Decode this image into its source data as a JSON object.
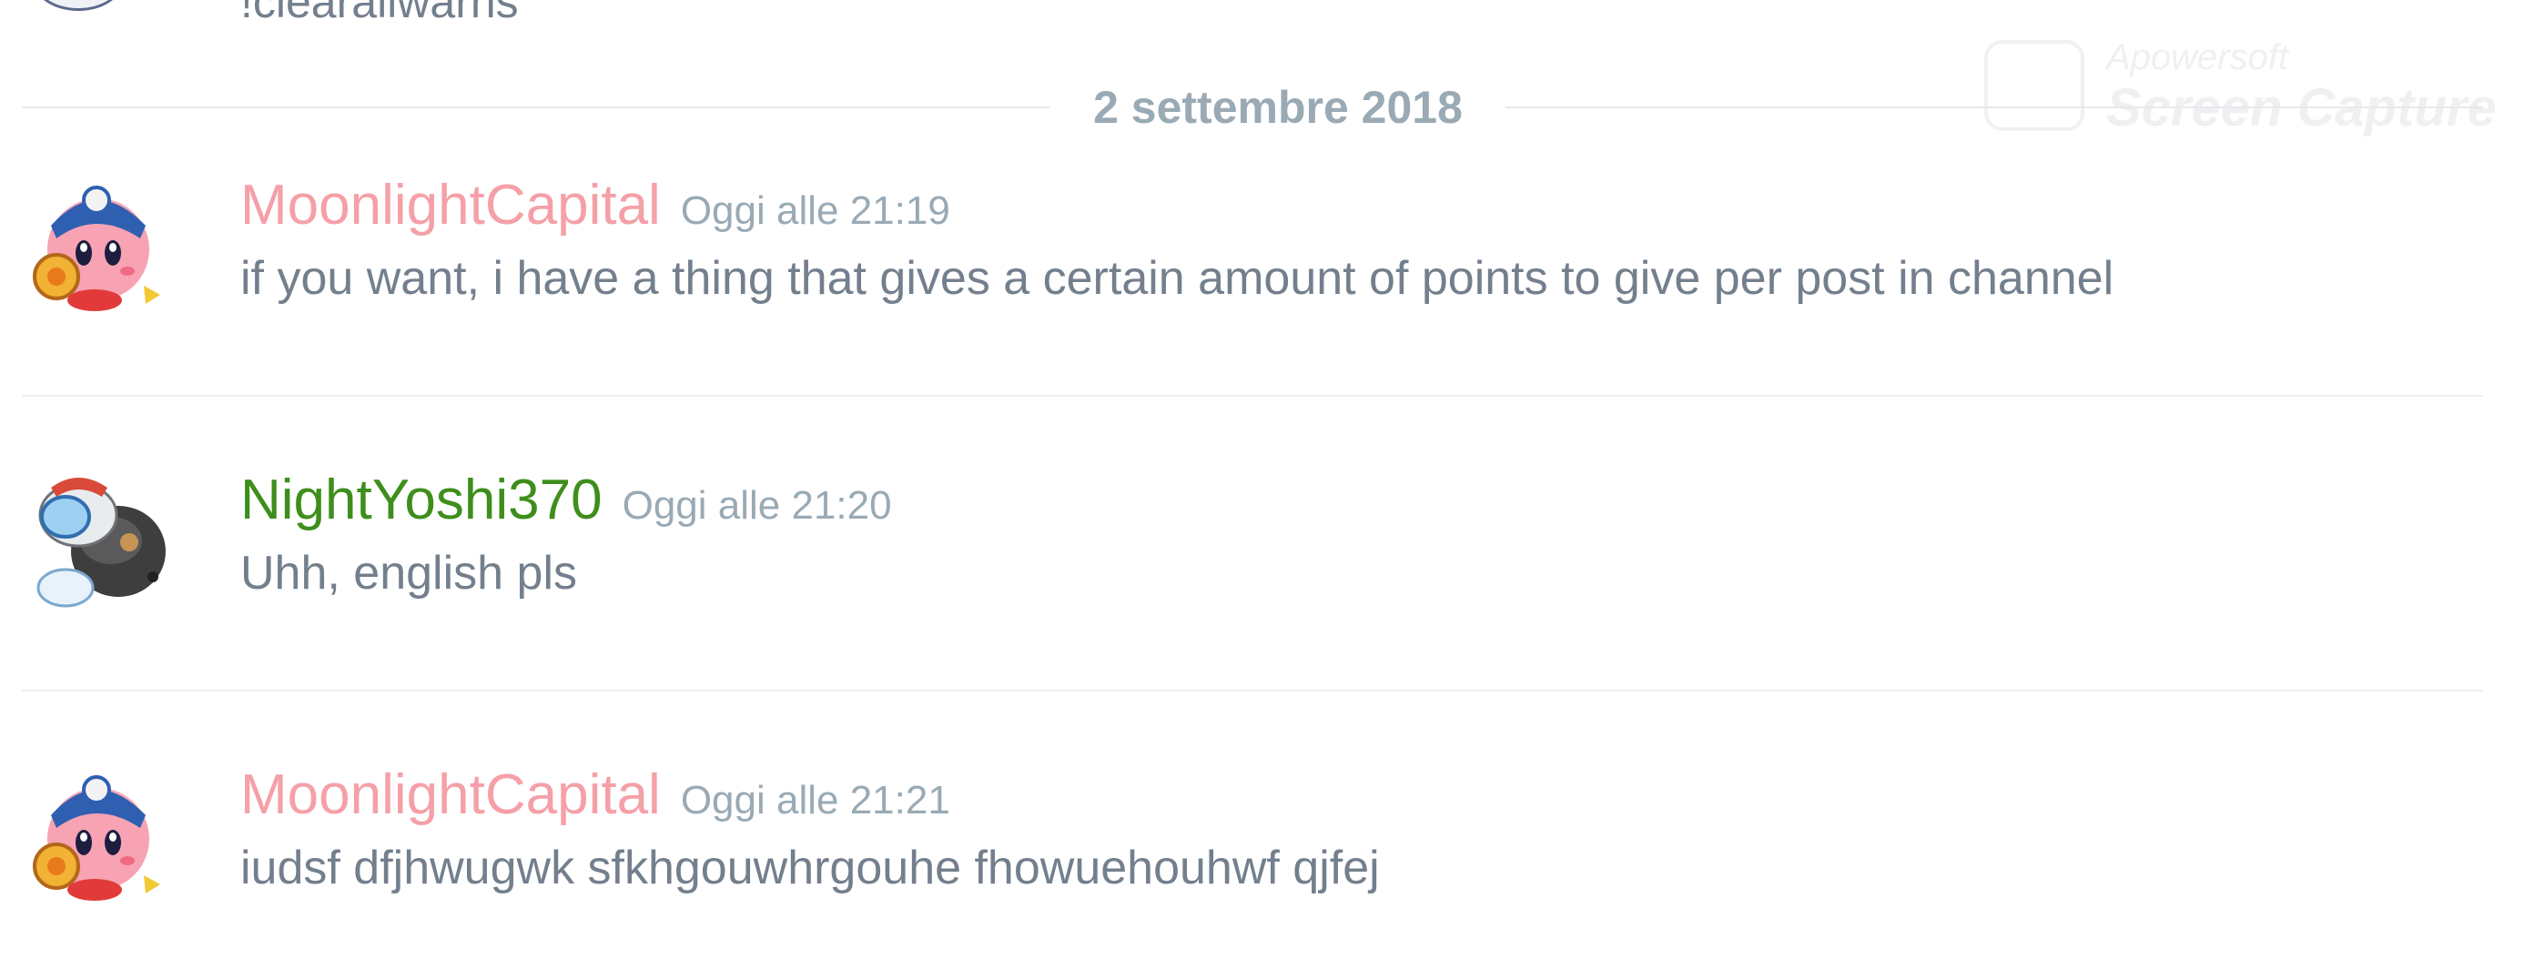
{
  "previous_message": {
    "content": "!clearallwarns"
  },
  "day_divider": {
    "label": "2 settembre 2018"
  },
  "messages": [
    {
      "username": "MoonlightCapital",
      "username_color": "#f5a0a8",
      "timestamp": "Oggi alle 21:19",
      "content": "if you want, i have a thing that gives a certain amount of points to give per post in channel",
      "avatar_icon": "kirby-character-avatar"
    },
    {
      "username": "NightYoshi370",
      "username_color": "#3e8e1c",
      "timestamp": "Oggi alle 21:20",
      "content": "Uhh, english pls",
      "avatar_icon": "yoshi-character-avatar"
    },
    {
      "username": "MoonlightCapital",
      "username_color": "#f5a0a8",
      "timestamp": "Oggi alle 21:21",
      "content": "iudsf dfjhwugwk sfkhgouwhrgouhe fhowuehouhwf qjfej",
      "avatar_icon": "kirby-character-avatar"
    }
  ],
  "watermark": {
    "brand": "Apowersoft",
    "product": "Screen Capture"
  },
  "colors": {
    "message_text": "#737f8d",
    "timestamp": "#99aab5",
    "divider_label": "#99aab5",
    "separator": "#eceef1"
  }
}
